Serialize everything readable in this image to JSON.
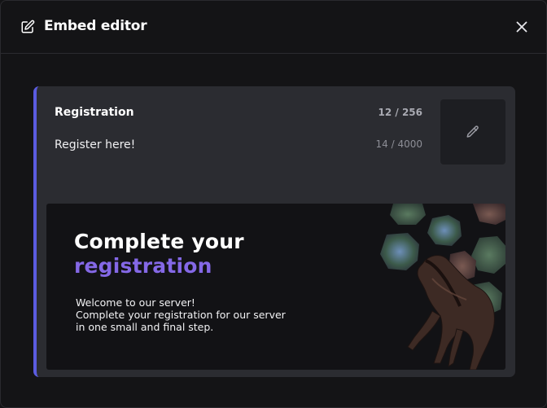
{
  "header": {
    "title": "Embed editor",
    "icon": "edit-square-icon",
    "close_icon": "close-icon"
  },
  "embed": {
    "accent_color": "#5b5ce0",
    "title": "Registration",
    "title_count": "12 / 256",
    "description": "Register here!",
    "description_count": "14 / 4000",
    "thumbnail_icon": "pencil-icon"
  },
  "banner": {
    "heading_line1": "Complete your",
    "heading_line2": "registration",
    "heading_accent_color": "#8468e6",
    "text_line1": "Welcome to our server!",
    "text_line2": "Complete your registration for our server",
    "text_line3": "in one small and final step."
  }
}
